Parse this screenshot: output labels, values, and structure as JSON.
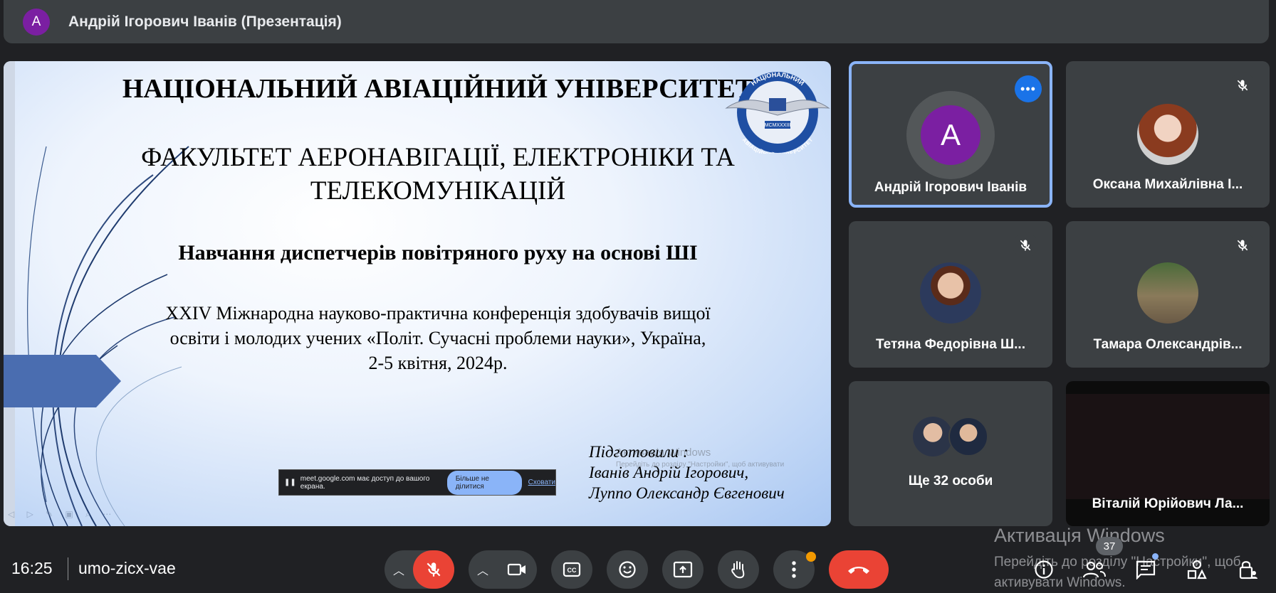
{
  "header": {
    "avatar_letter": "A",
    "title": "Андрій Ігорович Іванів (Презентація)"
  },
  "slide": {
    "university": "НАЦІОНАЛЬНИЙ АВІАЦІЙНИЙ УНІВЕРСИТЕТ",
    "faculty": "ФАКУЛЬТЕТ АЕРОНАВІГАЦІЇ, ЕЛЕКТРОНІКИ ТА ТЕЛЕКОМУНІКАЦІЙ",
    "topic": "Навчання диспетчерів повітряного руху на основі ШІ",
    "conference": "XXIV Міжнародна науково-практична конференція здобувачів вищої освіти і молодих учених «Політ. Сучасні проблеми науки», Україна, 2-5 квітня, 2024р.",
    "prepared_label": "Підготовили :",
    "author1": "Іванів Андрій Ігорович,",
    "author2": "Луппо Олександр Євгенович",
    "logo_text_top": "НАЦІОНАЛЬНИЙ",
    "logo_text_bottom": "АВІАЦІЙНИЙ УНІВЕРСИТЕТ",
    "logo_year": "MCMXXXIII",
    "ghost_activate_title": "Активація Windows",
    "ghost_activate_sub": "Перейдіть до розділу \"Настройки\", щоб активувати",
    "share_bar": {
      "message": "meet.google.com має доступ до вашого екрана.",
      "stop_button": "Більше не ділитися",
      "hide_link": "Сховати"
    }
  },
  "participants": [
    {
      "name": "Андрій Ігорович Іванів",
      "avatar_letter": "A",
      "avatar_color": "#7b1fa2",
      "speaking": true
    },
    {
      "name": "Оксана Михайлівна І...",
      "muted": true
    },
    {
      "name": "Тетяна Федорівна Ш...",
      "muted": true
    },
    {
      "name": "Тамара Олександрів...",
      "muted": true
    },
    {
      "name": "Ще 32 особи"
    },
    {
      "name": "Віталій Юрійович Ла...",
      "muted": true
    }
  ],
  "footer": {
    "time": "16:25",
    "meeting_code": "umo-zicx-vae",
    "participant_count": "37"
  },
  "watermark": {
    "title": "Активація Windows",
    "line1": "Перейдіть до розділу \"Настройки\", щоб",
    "line2": "активувати Windows."
  },
  "colors": {
    "background": "#202124",
    "tile": "#3c4043",
    "accent_blue": "#8ab4f8",
    "end_call_red": "#ea4335",
    "more_dot_orange": "#f29900"
  }
}
